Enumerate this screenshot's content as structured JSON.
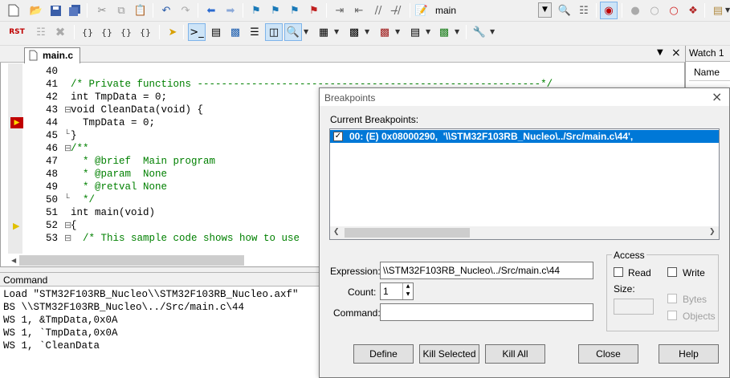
{
  "toolbar": {
    "target_name": "main"
  },
  "editor": {
    "tab_label": "main.c",
    "lines": [
      {
        "num": "40",
        "text": ""
      },
      {
        "num": "41",
        "text": "/* Private functions ---------------------------------------------------------*/"
      },
      {
        "num": "42",
        "text": "int TmpData = 0;"
      },
      {
        "num": "43",
        "text": "void CleanData(void) {"
      },
      {
        "num": "44",
        "text": "  TmpData = 0;"
      },
      {
        "num": "45",
        "text": "}"
      },
      {
        "num": "46",
        "text": "/**"
      },
      {
        "num": "47",
        "text": "  * @brief  Main program"
      },
      {
        "num": "48",
        "text": "  * @param  None"
      },
      {
        "num": "49",
        "text": "  * @retval None"
      },
      {
        "num": "50",
        "text": "  */"
      },
      {
        "num": "51",
        "text": "int main(void)"
      },
      {
        "num": "52",
        "text": "{"
      },
      {
        "num": "53",
        "text": "  /* This sample code shows how to use"
      }
    ]
  },
  "watch": {
    "title": "Watch 1",
    "column": "Name"
  },
  "command": {
    "title": "Command",
    "lines": [
      "Load \"STM32F103RB_Nucleo\\\\STM32F103RB_Nucleo.axf\"",
      "BS \\\\STM32F103RB_Nucleo\\../Src/main.c\\44",
      "WS 1, &TmpData,0x0A",
      "WS 1, `TmpData,0x0A",
      "WS 1, `CleanData"
    ]
  },
  "dialog": {
    "title": "Breakpoints",
    "current_label": "Current Breakpoints:",
    "breakpoint_item": "00: (E) 0x08000290,  '\\\\STM32F103RB_Nucleo\\../Src/main.c\\44',",
    "expression_label": "Expression:",
    "expression_value": "\\\\STM32F103RB_Nucleo\\../Src/main.c\\44",
    "count_label": "Count:",
    "count_value": "1",
    "command_label": "Command:",
    "command_value": "",
    "access_label": "Access",
    "read_label": "Read",
    "write_label": "Write",
    "size_label": "Size:",
    "bytes_label": "Bytes",
    "objects_label": "Objects",
    "define_btn": "Define",
    "kill_selected_btn": "Kill Selected",
    "kill_all_btn": "Kill All",
    "close_btn": "Close",
    "help_btn": "Help"
  }
}
